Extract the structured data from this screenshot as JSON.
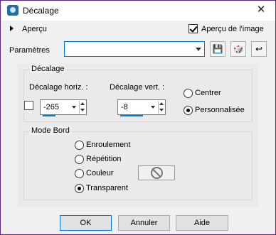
{
  "window": {
    "title": "Décalage",
    "close_glyph": "✕"
  },
  "preview": {
    "label": "Aperçu",
    "checkbox_label": "Aperçu de l'image",
    "checked": true
  },
  "params": {
    "label": "Paramètres",
    "value": ""
  },
  "toolbar": {
    "save_icon": "💾",
    "random_icon": "🎲",
    "reset_icon": "↩"
  },
  "offset_group": {
    "title": "Décalage",
    "horiz_label": "Décalage horiz. :",
    "horiz_value": "-265",
    "vert_label": "Décalage vert. :",
    "vert_value": "-8",
    "link_checked": false,
    "options": [
      {
        "label": "Centrer",
        "selected": false
      },
      {
        "label": "Personnalisée",
        "selected": true
      }
    ]
  },
  "edge_group": {
    "title": "Mode Bord",
    "options": [
      {
        "label": "Enroulement",
        "selected": false
      },
      {
        "label": "Répétition",
        "selected": false
      },
      {
        "label": "Couleur",
        "selected": false
      },
      {
        "label": "Transparent",
        "selected": true
      }
    ]
  },
  "buttons": {
    "ok": "OK",
    "cancel": "Annuler",
    "help": "Aide"
  },
  "colors": {
    "accent": "#0078d7",
    "window_bg": "#f0f0f0",
    "frame": "#6a3a8c"
  }
}
